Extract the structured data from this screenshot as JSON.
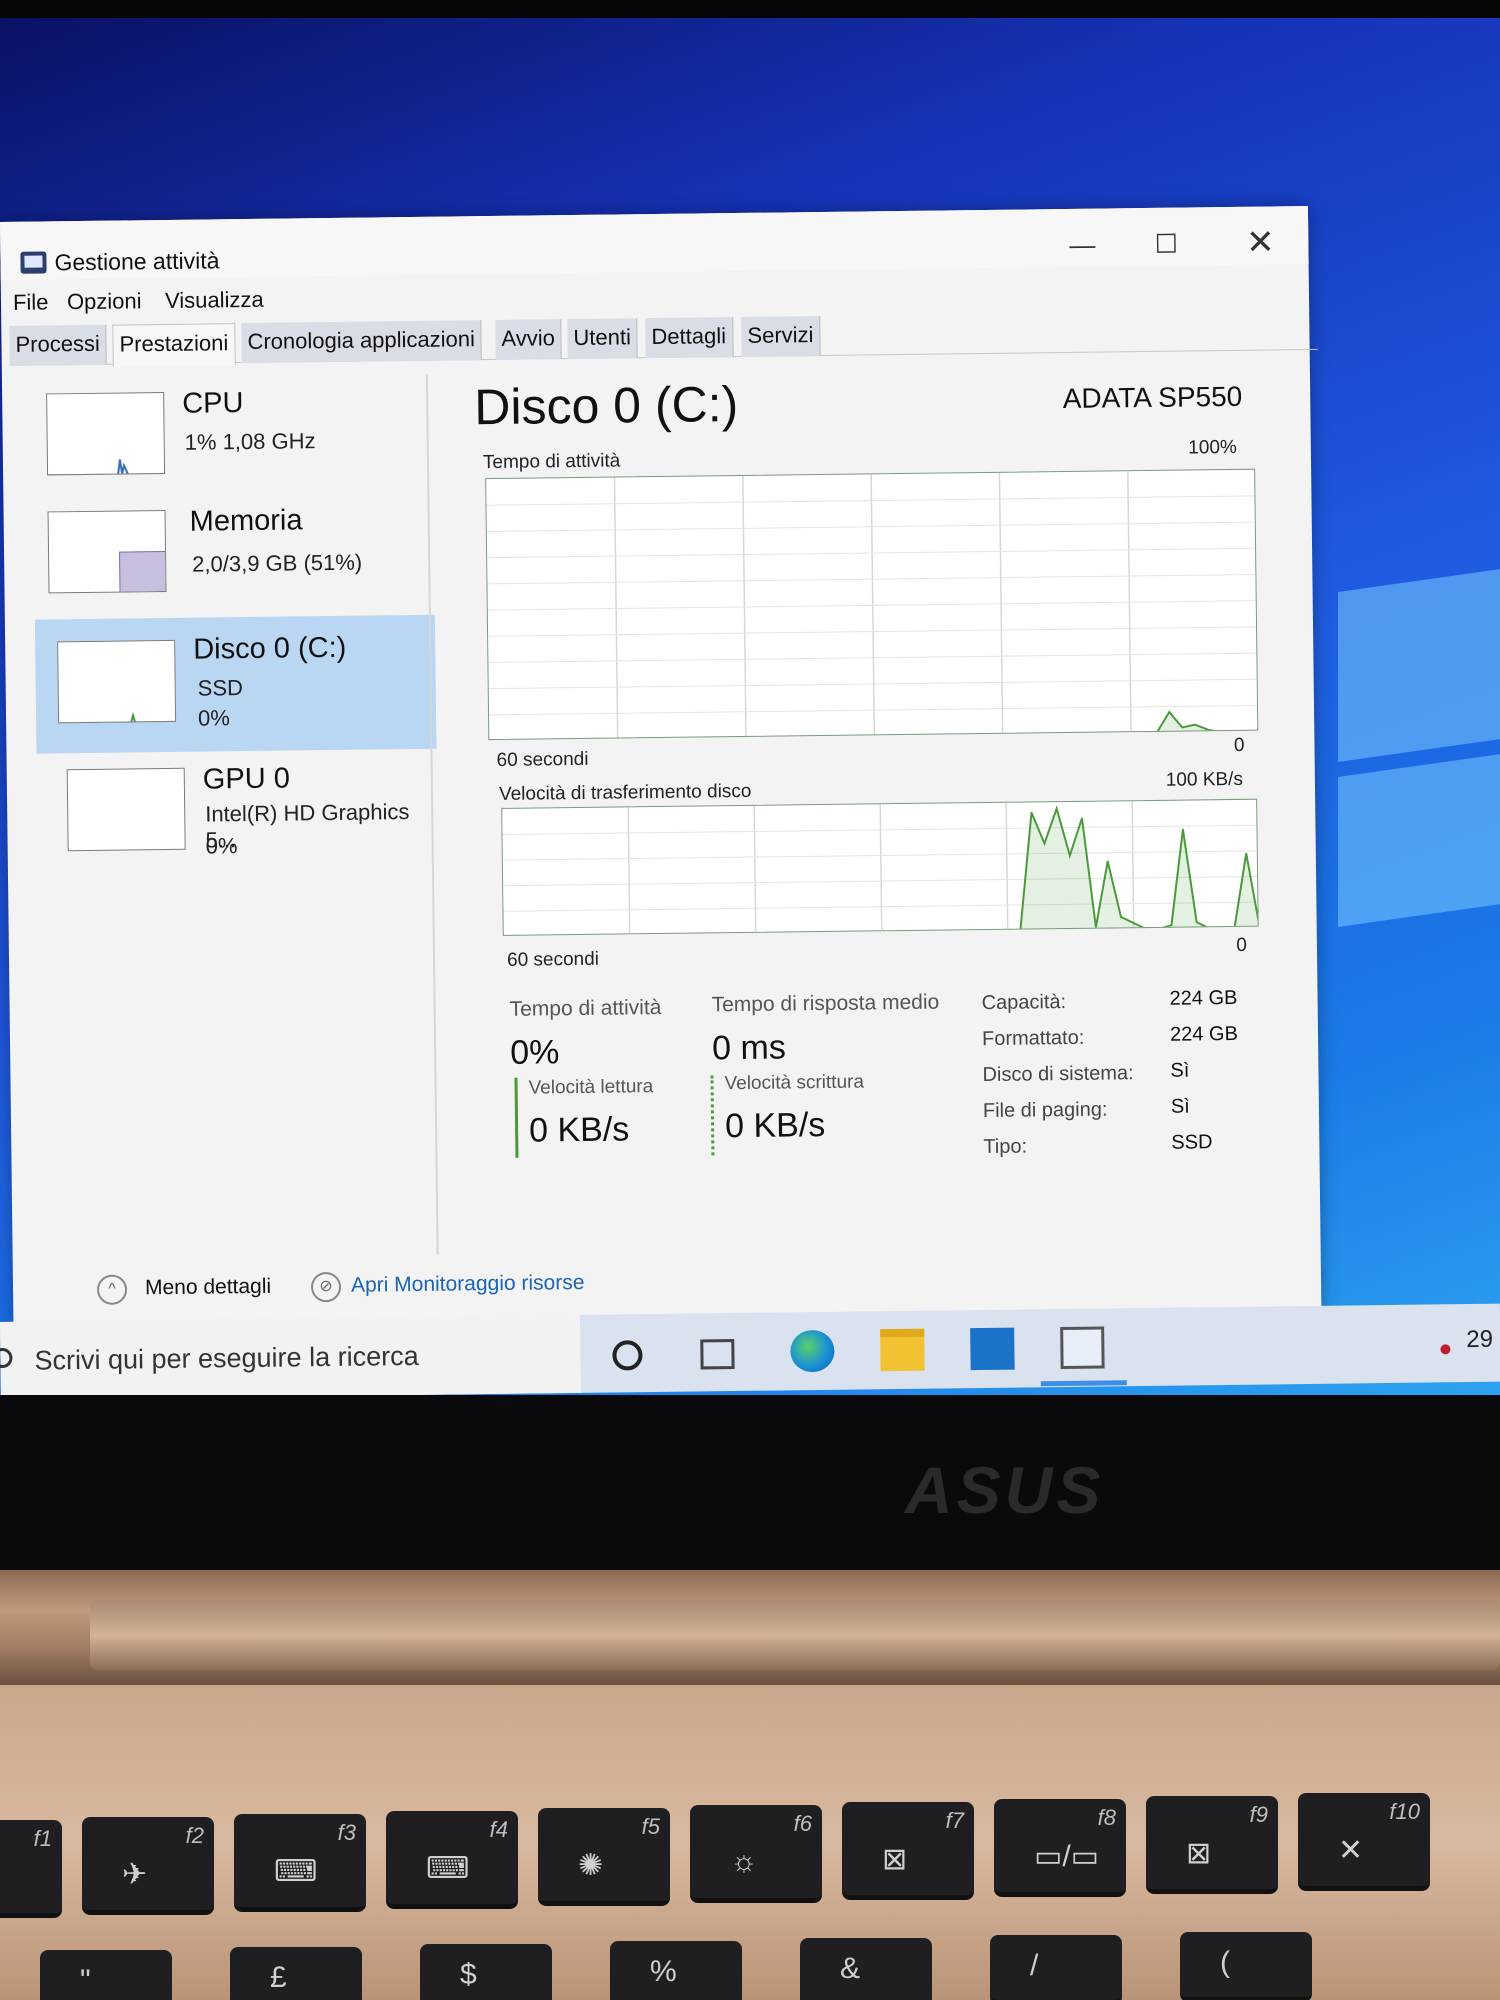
{
  "window": {
    "title": "Gestione attività",
    "controls": {
      "minimize": "—",
      "maximize": "☐",
      "close": "✕"
    }
  },
  "menu": [
    "File",
    "Opzioni",
    "Visualizza"
  ],
  "tabs": [
    "Processi",
    "Prestazioni",
    "Cronologia applicazioni",
    "Avvio",
    "Utenti",
    "Dettagli",
    "Servizi"
  ],
  "active_tab": "Prestazioni",
  "sidebar": {
    "items": [
      {
        "name": "CPU",
        "line1": "1%  1,08 GHz",
        "line2": ""
      },
      {
        "name": "Memoria",
        "line1": "2,0/3,9 GB (51%)",
        "line2": ""
      },
      {
        "name": "Disco 0 (C:)",
        "line1": "SSD",
        "line2": "0%"
      },
      {
        "name": "GPU 0",
        "line1": "Intel(R) HD Graphics 5...",
        "line2": "0%"
      }
    ],
    "selected": "Disco 0 (C:)"
  },
  "detail": {
    "title": "Disco 0 (C:)",
    "model": "ADATA SP550",
    "chart1": {
      "label": "Tempo di attività",
      "max": "100%",
      "xleft": "60 secondi",
      "xright": "0"
    },
    "chart2": {
      "label": "Velocità di trasferimento disco",
      "max": "100 KB/s",
      "xleft": "60 secondi",
      "xright": "0"
    },
    "stats": {
      "active_label": "Tempo di attività",
      "active_value": "0%",
      "response_label": "Tempo di risposta medio",
      "response_value": "0 ms",
      "read_label": "Velocità lettura",
      "read_value": "0 KB/s",
      "write_label": "Velocità scrittura",
      "write_value": "0 KB/s"
    },
    "info": [
      {
        "key": "Capacità:",
        "value": "224 GB"
      },
      {
        "key": "Formattato:",
        "value": "224 GB"
      },
      {
        "key": "Disco di sistema:",
        "value": "Sì"
      },
      {
        "key": "File di paging:",
        "value": "Sì"
      },
      {
        "key": "Tipo:",
        "value": "SSD"
      }
    ]
  },
  "chart_data": [
    {
      "type": "area",
      "ylabel": "Tempo di attività",
      "ylim": [
        0,
        100
      ],
      "xlim": [
        60,
        0
      ],
      "series": [
        {
          "values": [
            0,
            0,
            0,
            0,
            0,
            0,
            0,
            0,
            0,
            0,
            0,
            0,
            0,
            0,
            0,
            0,
            0,
            0,
            0,
            0,
            0,
            0,
            0,
            0,
            0,
            0,
            0,
            0,
            0,
            0,
            0,
            0,
            0,
            0,
            0,
            0,
            0,
            0,
            0,
            0,
            0,
            0,
            0,
            0,
            0,
            0,
            0,
            0,
            0,
            0,
            0,
            0,
            0,
            8,
            2,
            3,
            1,
            0,
            0,
            0,
            0
          ]
        }
      ]
    },
    {
      "type": "area",
      "ylabel": "Velocità di trasferimento disco",
      "ylim": [
        0,
        100
      ],
      "xlim": [
        60,
        0
      ],
      "series": [
        {
          "values": [
            0,
            0,
            0,
            0,
            0,
            0,
            0,
            0,
            0,
            0,
            0,
            0,
            0,
            0,
            0,
            0,
            0,
            0,
            0,
            0,
            0,
            0,
            0,
            0,
            0,
            0,
            0,
            0,
            0,
            0,
            0,
            0,
            0,
            0,
            0,
            0,
            0,
            0,
            0,
            0,
            0,
            0,
            95,
            70,
            98,
            60,
            90,
            2,
            55,
            10,
            5,
            0,
            0,
            3,
            80,
            5,
            0,
            0,
            0,
            60,
            0
          ]
        }
      ]
    }
  ],
  "footer": {
    "less_details": "Meno dettagli",
    "resource_monitor": "Apri Monitoraggio risorse"
  },
  "taskbar": {
    "search_placeholder": "Scrivi qui per eseguire la ricerca",
    "tray_text": "29"
  },
  "laptop": {
    "brand": "ASUS",
    "fkeys": [
      "f1",
      "f2",
      "f3",
      "f4",
      "f5",
      "f6",
      "f7",
      "f8",
      "f9",
      "f10"
    ],
    "number_row": [
      "\"",
      "£",
      "$",
      "%",
      "&",
      "/",
      "("
    ]
  },
  "colors": {
    "disk_green": "#4a9a3c",
    "selection": "#b9d6f2",
    "link_blue": "#1a64b4"
  }
}
